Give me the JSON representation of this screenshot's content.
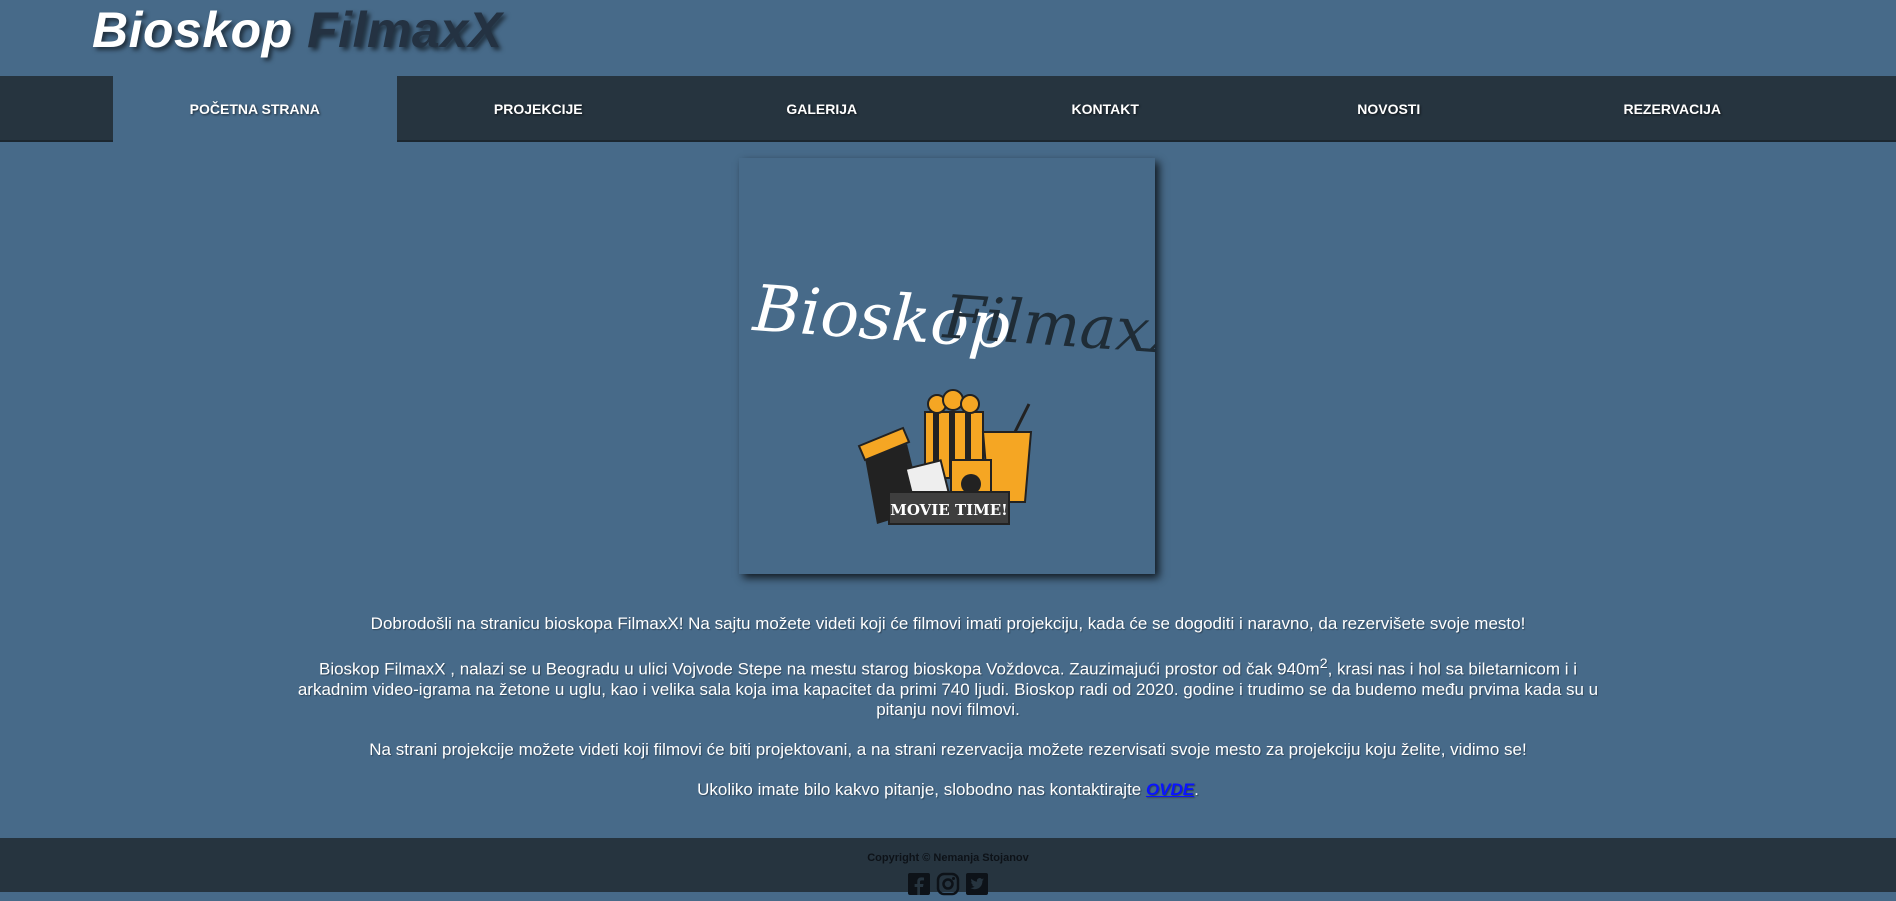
{
  "header": {
    "title_part1": "Bioskop ",
    "title_part2": "FilmaxX"
  },
  "nav": {
    "items": [
      {
        "label": "POČETNA STRANA"
      },
      {
        "label": "PROJEKCIJE"
      },
      {
        "label": "GALERIJA"
      },
      {
        "label": "KONTAKT"
      },
      {
        "label": "NOVOSTI"
      },
      {
        "label": "REZERVACIJA"
      }
    ]
  },
  "logo": {
    "title_left": "Bioskop",
    "title_right": "FilmaxX",
    "banner": "MOVIE TIME!"
  },
  "content": {
    "p1": "Dobrodošli na stranicu bioskopa FilmaxX! Na sajtu možete videti koji će filmovi imati projekciju, kada će se dogoditi i naravno, da rezervišete svoje mesto!",
    "p2_before": "Bioskop FilmaxX , nalazi se u Beogradu u ulici Vojvode Stepe na mestu starog bioskopa Voždovca. Zauzimajući prostor od čak 940m",
    "p2_sup": "2",
    "p2_after": ", krasi nas i hol sa biletarnicom i i arkadnim video-igrama na žetone u uglu, kao i velika sala koja ima kapacitet da primi 740 ljudi. Bioskop radi od 2020. godine i trudimo se da budemo među prvima kada su u pitanju novi filmovi.",
    "p3": "Na strani projekcije možete videti koji filmovi će biti projektovani, a na strani rezervacija možete rezervisati svoje mesto za projekciju koju želite, vidimo se!",
    "p4_before": "Ukoliko imate bilo kakvo pitanje, slobodno nas kontaktirajte ",
    "p4_link": "OVDE",
    "p4_after": "."
  },
  "footer": {
    "copyright": "Copyright © Nemanja Stojanov"
  },
  "social": [
    "facebook-icon",
    "instagram-icon",
    "twitter-icon"
  ],
  "colors": {
    "background": "#476a89",
    "nav": "#26343f",
    "link": "#0a14ff",
    "accent": "#f5a623"
  }
}
